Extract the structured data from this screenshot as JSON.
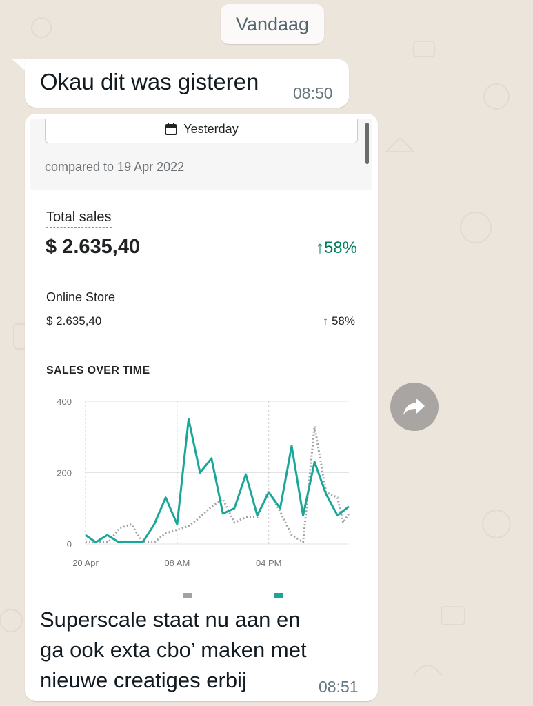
{
  "chat": {
    "date_divider": "Vandaag",
    "messages": [
      {
        "text": "Okau dit was gisteren",
        "time": "08:50"
      },
      {
        "text": "Superscale staat nu aan en\nga ook exta cbo’ maken met\nnieuwe creatiges erbij",
        "time": "08:51"
      }
    ],
    "forward_icon": "forward-arrow-icon"
  },
  "screenshot": {
    "date_button": "Yesterday",
    "date_icon": "calendar-icon",
    "compared": "compared to 19 Apr 2022",
    "total_sales": {
      "label": "Total sales",
      "value": "$ 2.635,40",
      "change": "58%",
      "arrow": "↑"
    },
    "online_store": {
      "label": "Online Store",
      "value": "$ 2.635,40",
      "change": "58%",
      "arrow": "↑"
    },
    "section_title": "SALES OVER TIME"
  },
  "colors": {
    "accent_green": "#008060",
    "current_line": "#1aa79a",
    "previous_line": "#a0a3a6"
  },
  "chart_data": {
    "type": "line",
    "y_ticks": [
      "0",
      "200",
      "400"
    ],
    "ylim": [
      0,
      400
    ],
    "x_ticks": [
      {
        "label": "20 Apr",
        "hour": 0
      },
      {
        "label": "08 AM",
        "hour": 8
      },
      {
        "label": "04 PM",
        "hour": 16
      }
    ],
    "xlim": [
      0,
      23
    ],
    "grid": true,
    "series": [
      {
        "style": "solid",
        "values": [
          25,
          5,
          25,
          5,
          5,
          5,
          5,
          55,
          130,
          55,
          350,
          200,
          240,
          85,
          100,
          195,
          80,
          145,
          100,
          275,
          80,
          230,
          140,
          80,
          105
        ],
        "x": [
          0,
          0.9,
          1.9,
          2.9,
          3.9,
          4.9,
          5,
          6,
          7,
          8,
          9,
          10,
          11,
          12,
          13,
          14,
          15,
          16,
          17,
          18,
          19,
          20,
          21,
          22,
          23
        ]
      },
      {
        "style": "dotted",
        "values": [
          5,
          5,
          5,
          45,
          55,
          5,
          5,
          30,
          40,
          50,
          75,
          105,
          125,
          60,
          75,
          75,
          150,
          90,
          25,
          5,
          330,
          145,
          130,
          60,
          85
        ],
        "x": [
          0,
          1,
          2,
          3,
          4,
          5,
          6,
          7,
          8,
          9,
          10,
          11,
          12,
          13,
          14,
          15,
          16,
          17,
          18,
          19,
          20,
          21,
          22,
          22.5,
          23
        ]
      }
    ]
  }
}
